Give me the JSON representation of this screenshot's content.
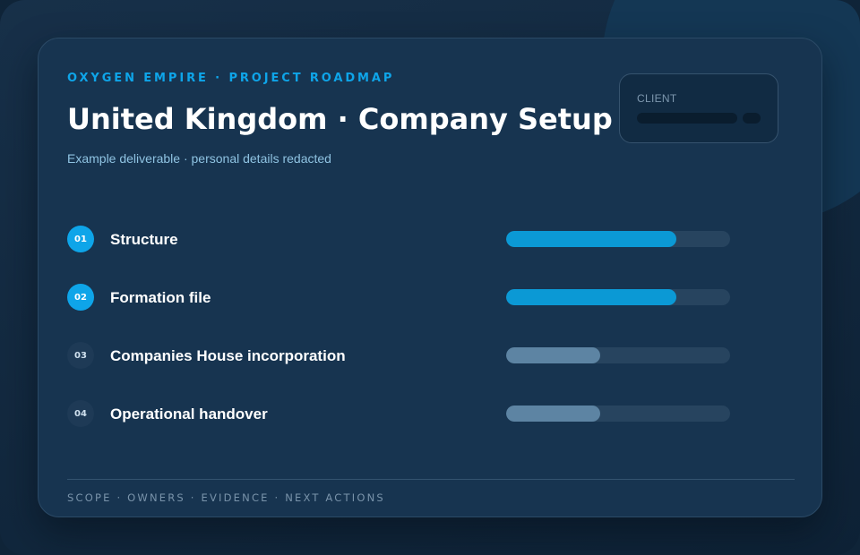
{
  "header": {
    "eyebrow": "OXYGEN EMPIRE · PROJECT ROADMAP",
    "title": "United Kingdom · Company Setup",
    "subtitle": "Example deliverable · personal details redacted"
  },
  "client": {
    "label": "CLIENT"
  },
  "steps": [
    {
      "number": "01",
      "label": "Structure",
      "status": "active",
      "progress": 0.76
    },
    {
      "number": "02",
      "label": "Formation file",
      "status": "active",
      "progress": 0.76
    },
    {
      "number": "03",
      "label": "Companies House incorporation",
      "status": "pending",
      "progress": 0.42
    },
    {
      "number": "04",
      "label": "Operational handover",
      "status": "pending",
      "progress": 0.42
    }
  ],
  "footer": {
    "text": "SCOPE · OWNERS · EVIDENCE · NEXT ACTIONS"
  },
  "colors": {
    "accent": "#0ea5e9",
    "active_fill": "#0b99d5",
    "pending_fill": "#5d84a3",
    "track": "#27445f"
  }
}
